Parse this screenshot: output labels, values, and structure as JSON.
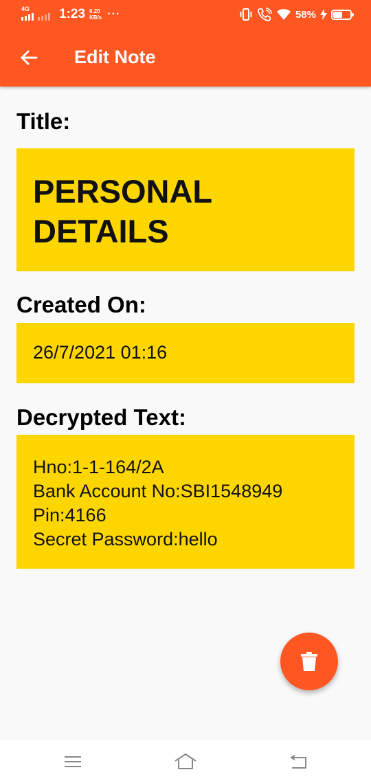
{
  "status_bar": {
    "network_type": "4G",
    "time": "1:23",
    "speed_value": "0.20",
    "speed_unit": "KB/s",
    "more": "···",
    "battery_percent": "58%",
    "battery_level": 0.58,
    "icons": [
      "signal-icon",
      "vibrate-icon",
      "wifi-call-icon",
      "wifi-icon",
      "charging-icon",
      "battery-icon"
    ]
  },
  "app_bar": {
    "title": "Edit Note",
    "back_icon": "arrow-left-icon",
    "background_color": "#ff5722"
  },
  "note": {
    "title_label": "Title:",
    "title_line1": "PERSONAL",
    "title_line2": "DETAILS",
    "created_label": "Created On:",
    "created_value": "26/7/2021 01:16",
    "decrypted_label": "Decrypted Text:",
    "decrypted_lines": [
      "Hno:1-1-164/2A",
      "Bank Account No:SBI1548949",
      "Pin:4166",
      "Secret Password:hello"
    ],
    "field_color": "#fdd600"
  },
  "fab": {
    "icon": "delete-icon",
    "color": "#ff5722"
  },
  "nav_bar": {
    "icons": [
      "menu-icon",
      "home-icon",
      "back-icon"
    ]
  }
}
